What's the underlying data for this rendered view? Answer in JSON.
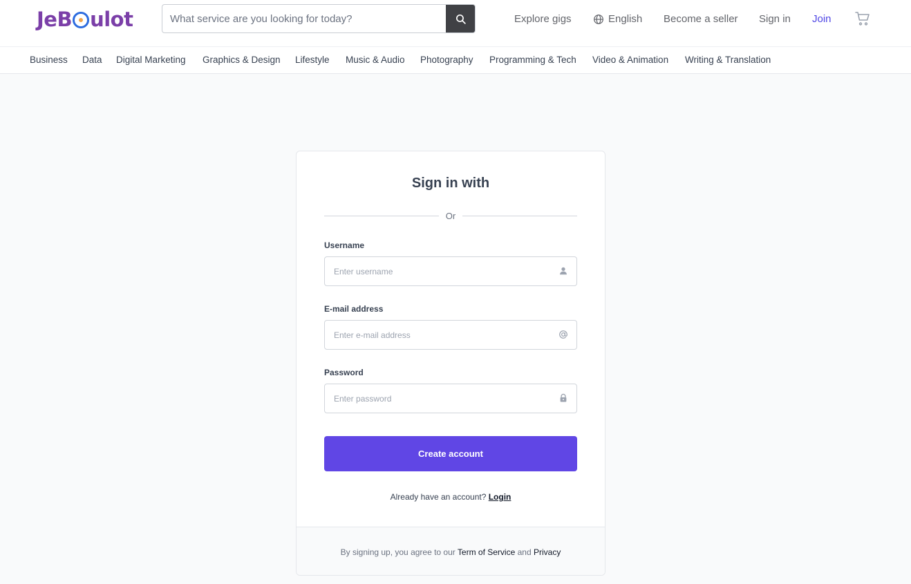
{
  "header": {
    "logo_text": "JeBoulot",
    "search": {
      "placeholder": "What service are you looking for today?",
      "value": "",
      "icon": "search-icon"
    },
    "nav": {
      "explore": "Explore gigs",
      "language": "English",
      "become_seller": "Become a seller",
      "sign_in": "Sign in",
      "join": "Join"
    },
    "cart_icon": "cart-icon"
  },
  "categories": [
    "Business",
    "Data",
    "Digital Marketing",
    "Graphics & Design",
    "Lifestyle",
    "Music & Audio",
    "Photography",
    "Programming & Tech",
    "Video & Animation",
    "Writing & Translation"
  ],
  "form": {
    "title": "Sign in with",
    "divider": "Or",
    "username": {
      "label": "Username",
      "placeholder": "Enter username",
      "value": "",
      "icon": "user-icon"
    },
    "email": {
      "label": "E-mail address",
      "placeholder": "Enter e-mail address",
      "value": "",
      "icon": "at-icon"
    },
    "password": {
      "label": "Password",
      "placeholder": "Enter password",
      "value": "",
      "icon": "lock-icon"
    },
    "submit": "Create account",
    "already_text": "Already have an account?",
    "login_link": "Login",
    "terms": {
      "prefix": "By signing up, you agree to our",
      "tos": "Term of Service",
      "and": "and",
      "privacy": "Privacy"
    }
  },
  "colors": {
    "brand": "#7b3fa8",
    "primary": "#6046e5",
    "join_link": "#4f46e5",
    "search_button": "#404145"
  }
}
